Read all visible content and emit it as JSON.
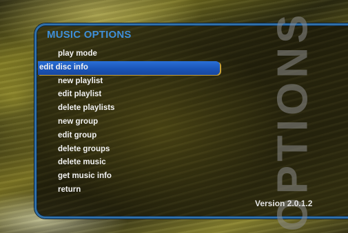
{
  "menu": {
    "title": "MUSIC OPTIONS",
    "selected_index": 1,
    "items": [
      {
        "label": "play mode"
      },
      {
        "label": "edit disc info"
      },
      {
        "label": "new playlist"
      },
      {
        "label": "edit playlist"
      },
      {
        "label": "delete playlists"
      },
      {
        "label": "new group"
      },
      {
        "label": "edit group"
      },
      {
        "label": "delete groups"
      },
      {
        "label": "delete music"
      },
      {
        "label": "get music info"
      },
      {
        "label": "return"
      }
    ]
  },
  "watermark": "OPTIONS",
  "version": "Version 2.0.1.2",
  "colors": {
    "title": "#3f8fd8",
    "panel_border": "#2f6fa8",
    "selection": "#1a55b8",
    "background_tint": "#7d7524"
  }
}
